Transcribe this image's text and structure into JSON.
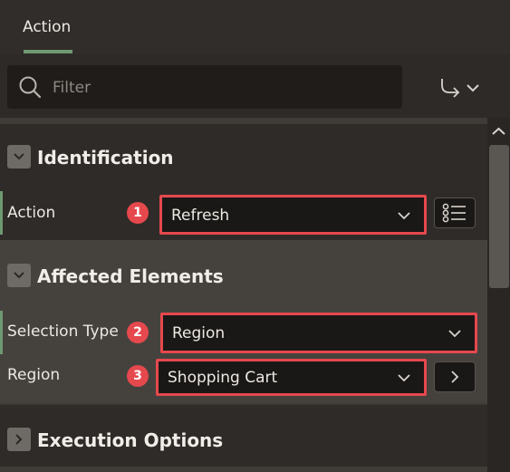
{
  "tab": {
    "label": "Action"
  },
  "filter": {
    "placeholder": "Filter"
  },
  "sections": {
    "identification": {
      "title": "Identification",
      "action_label": "Action",
      "action_value": "Refresh",
      "badge": "1"
    },
    "affected": {
      "title": "Affected Elements",
      "selection_type_label": "Selection Type",
      "selection_type_value": "Region",
      "selection_badge": "2",
      "region_label": "Region",
      "region_value": "Shopping Cart",
      "region_badge": "3"
    },
    "execution": {
      "title": "Execution Options"
    }
  },
  "colors": {
    "accent_green": "#6d9a71",
    "highlight_red": "#e5484d"
  }
}
